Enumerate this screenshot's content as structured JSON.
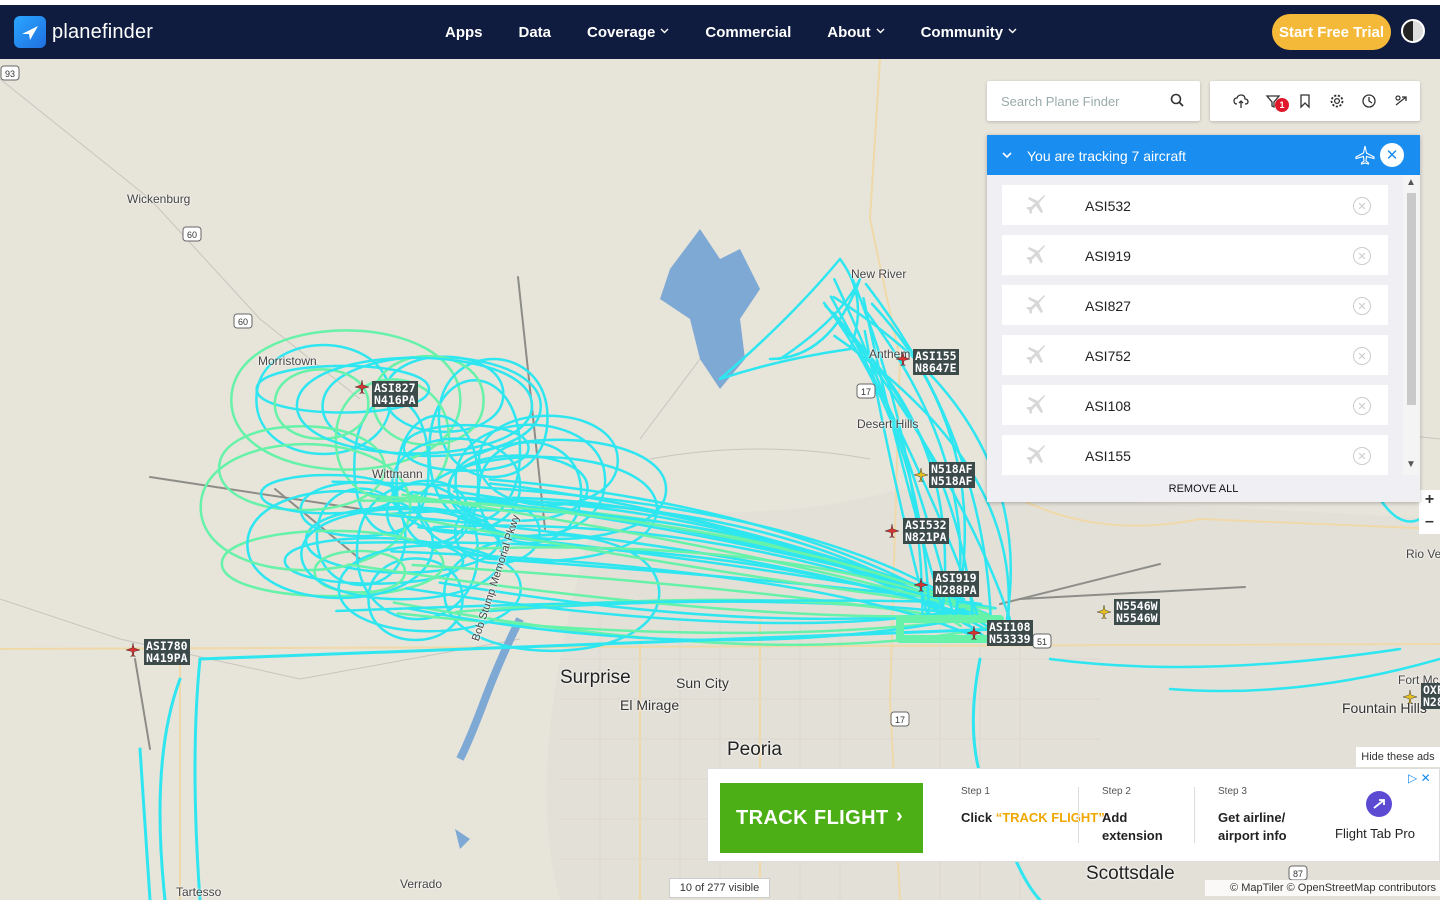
{
  "brand": {
    "name_a": "plane",
    "name_b": "finder"
  },
  "nav": {
    "items": [
      {
        "label": "Apps",
        "dropdown": false
      },
      {
        "label": "Data",
        "dropdown": false
      },
      {
        "label": "Coverage",
        "dropdown": true
      },
      {
        "label": "Commercial",
        "dropdown": false
      },
      {
        "label": "About",
        "dropdown": true
      },
      {
        "label": "Community",
        "dropdown": true
      }
    ],
    "trial_label": "Start Free Trial"
  },
  "search": {
    "placeholder": "Search Plane Finder"
  },
  "toolbar": {
    "filter_badge": "1"
  },
  "tracking": {
    "title": "You are tracking 7 aircraft",
    "items": [
      "ASI532",
      "ASI919",
      "ASI827",
      "ASI752",
      "ASI108",
      "ASI155"
    ],
    "remove_all": "REMOVE ALL"
  },
  "map": {
    "places": [
      {
        "name": "Wickenburg",
        "size": "small"
      },
      {
        "name": "Morristown",
        "size": "small"
      },
      {
        "name": "Wittmann",
        "size": "small"
      },
      {
        "name": "New River",
        "size": "small"
      },
      {
        "name": "Anthem",
        "size": "small"
      },
      {
        "name": "Desert Hills",
        "size": "small"
      },
      {
        "name": "Surprise",
        "size": "big"
      },
      {
        "name": "Sun City",
        "size": "med"
      },
      {
        "name": "El Mirage",
        "size": "med"
      },
      {
        "name": "Peoria",
        "size": "big"
      },
      {
        "name": "Scottsdale",
        "size": "big"
      },
      {
        "name": "Fountain Hills",
        "size": "med"
      },
      {
        "name": "Rio Ve",
        "size": "small"
      },
      {
        "name": "Fort Mc",
        "size": "small"
      },
      {
        "name": "Verrado",
        "size": "small"
      },
      {
        "name": "Tartesso",
        "size": "small"
      },
      {
        "name": "Bob Stump Memorial Pkwy",
        "size": "small"
      }
    ],
    "shields": [
      "93",
      "60",
      "60",
      "17",
      "17",
      "51",
      "87"
    ],
    "aircraft": [
      {
        "callsign": "ASI827",
        "reg": "N416PA",
        "color": "#d63333"
      },
      {
        "callsign": "ASI155",
        "reg": "N8647E",
        "color": "#d63333"
      },
      {
        "callsign": "N518AF",
        "reg": "N518AF",
        "color": "#e6c020"
      },
      {
        "callsign": "ASI532",
        "reg": "N821PA",
        "color": "#d63333"
      },
      {
        "callsign": "ASI919",
        "reg": "N288PA",
        "color": "#d63333"
      },
      {
        "callsign": "N5546W",
        "reg": "N5546W",
        "color": "#e6c020"
      },
      {
        "callsign": "ASI108",
        "reg": "N53339",
        "color": "#d63333"
      },
      {
        "callsign": "ASI780",
        "reg": "N419PA",
        "color": "#d63333"
      },
      {
        "callsign": "OXF",
        "reg": "N28",
        "color": "#e6c020"
      }
    ],
    "track_color": "#2ee6f0",
    "track_color_alt": "#66f2a8"
  },
  "ad": {
    "hide_label": "Hide these ads",
    "cta": "TRACK FLIGHT",
    "steps": [
      {
        "label": "Step 1",
        "text_a": "Click ",
        "text_b": "“TRACK FLIGHT”"
      },
      {
        "label": "Step 2",
        "text_a": "Add extension",
        "text_b": ""
      },
      {
        "label": "Step 3",
        "text_a": "Get airline/ airport info",
        "text_b": ""
      }
    ],
    "product": "Flight Tab Pro"
  },
  "footer": {
    "visible_count": "10 of 277 visible",
    "attribution": "© MapTiler © OpenStreetMap contributors"
  }
}
